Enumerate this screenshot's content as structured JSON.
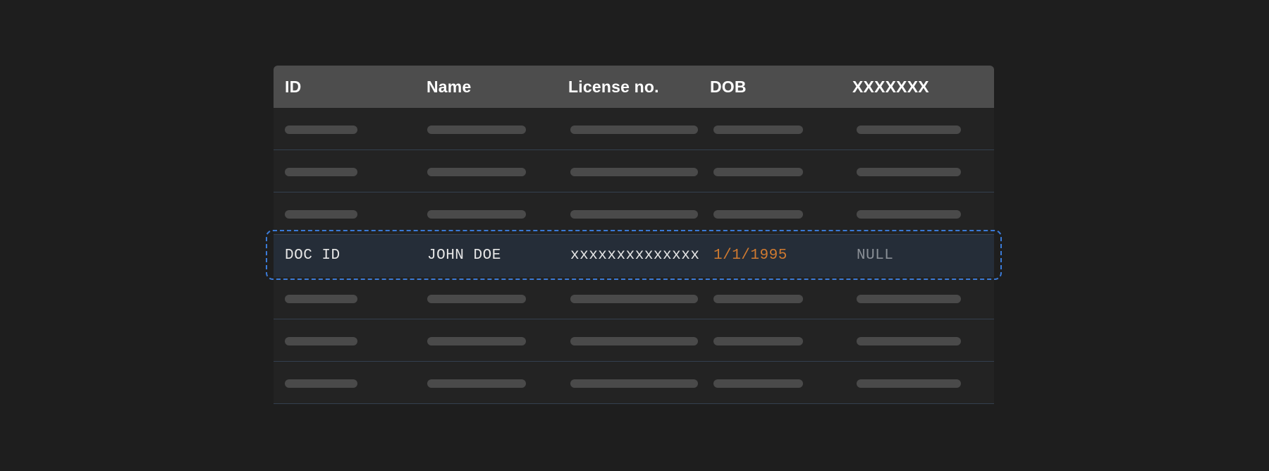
{
  "table": {
    "headers": [
      "ID",
      "Name",
      "License no.",
      "DOB",
      "XXXXXXX"
    ],
    "selected_row": {
      "id": "DOC ID",
      "name": "JOHN DOE",
      "license": "xxxxxxxxxxxxxx",
      "dob": "1/1/1995",
      "extra": "NULL"
    }
  },
  "colors": {
    "background": "#1e1e1e",
    "header_bg": "#4d4d4d",
    "row_bg": "#232323",
    "selected_row_bg": "#252d38",
    "selection_border": "#3b7bd8",
    "dob_accent": "#d07a30",
    "null_text": "#8a8f96",
    "placeholder_bar": "#4a4a4a"
  }
}
